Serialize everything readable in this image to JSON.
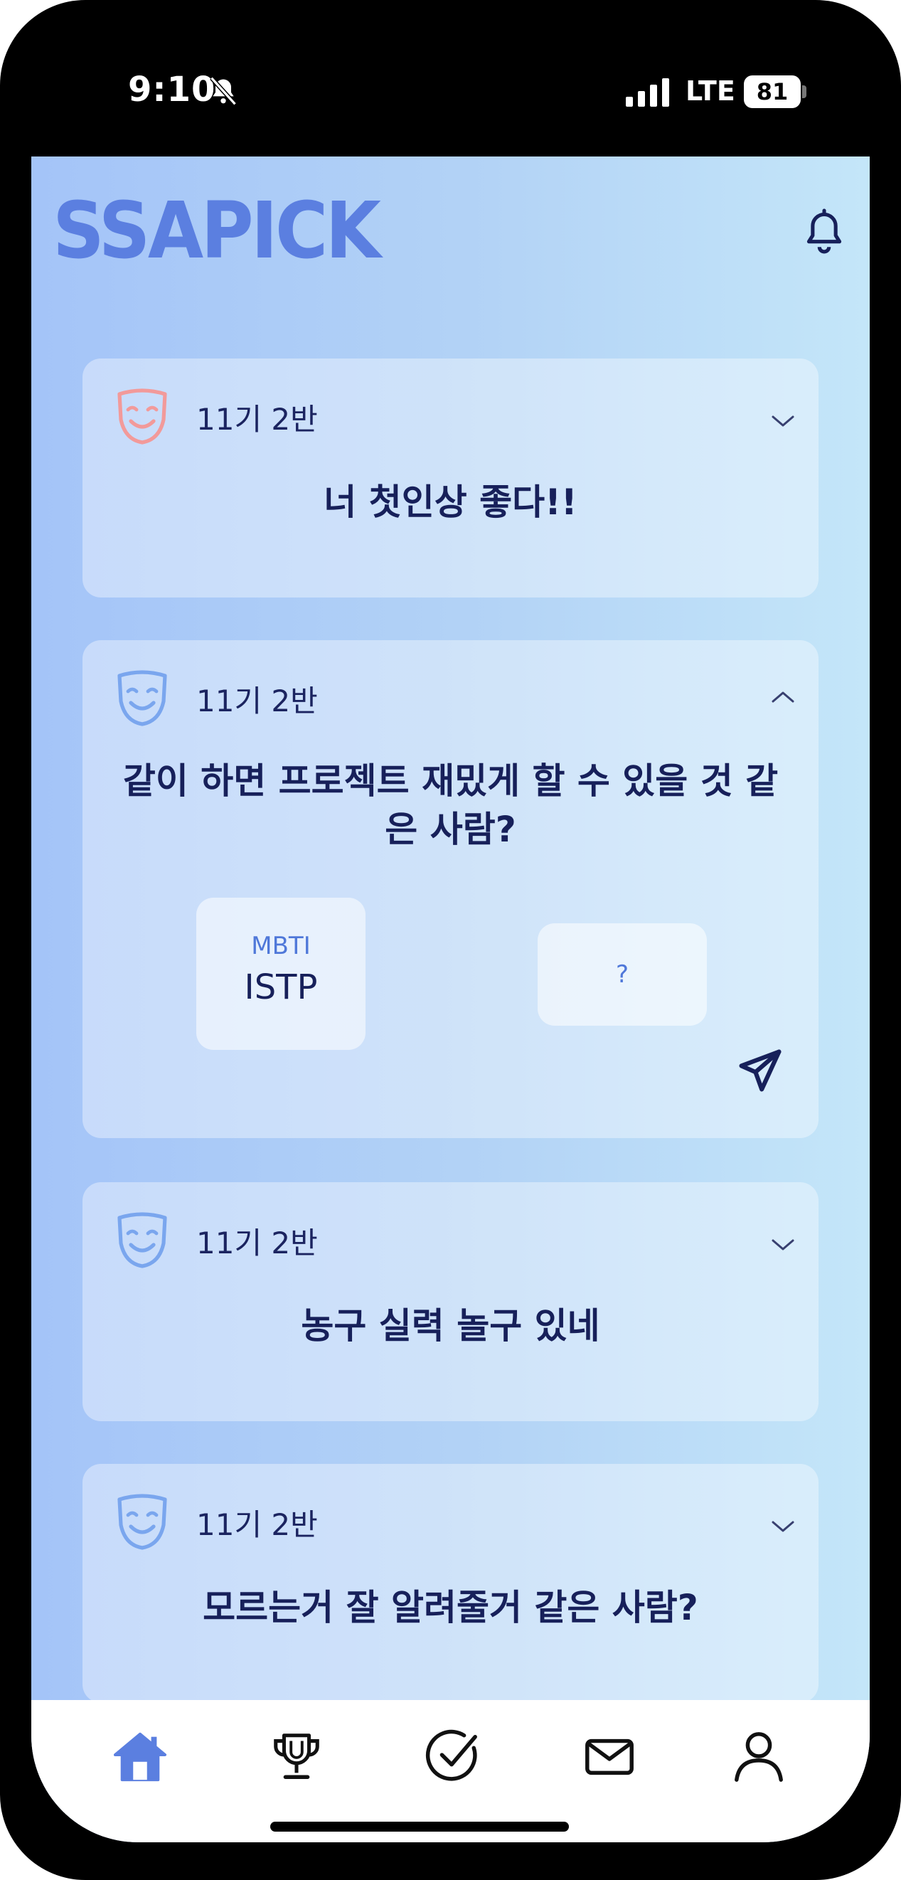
{
  "status_bar": {
    "time": "9:10",
    "network": "LTE",
    "battery": "81"
  },
  "header": {
    "logo": "SSAPICK"
  },
  "cards": [
    {
      "class_label": "11기 2반",
      "question": "너 첫인상 좋다!!",
      "expanded": false,
      "mask_color": "#f29a9a"
    },
    {
      "class_label": "11기 2반",
      "question": "같이 하면 프로젝트 재밌게 할 수 있을 것 같은 사람?",
      "expanded": true,
      "mask_color": "#7aa6ee",
      "hints": [
        {
          "title": "MBTI",
          "value": "ISTP"
        },
        {
          "title": "?"
        }
      ]
    },
    {
      "class_label": "11기 2반",
      "question": "농구 실력 놀구 있네",
      "expanded": false,
      "mask_color": "#7aa6ee"
    },
    {
      "class_label": "11기 2반",
      "question": "모르는거 잘 알려줄거 같은 사람?",
      "expanded": false,
      "mask_color": "#7aa6ee"
    }
  ],
  "tabs": [
    "home-icon",
    "trophy-icon",
    "check-icon",
    "mail-icon",
    "profile-icon"
  ],
  "colors": {
    "accent": "#5b7fe0",
    "text": "#17205a",
    "active_tab": "#5b7fe0"
  }
}
